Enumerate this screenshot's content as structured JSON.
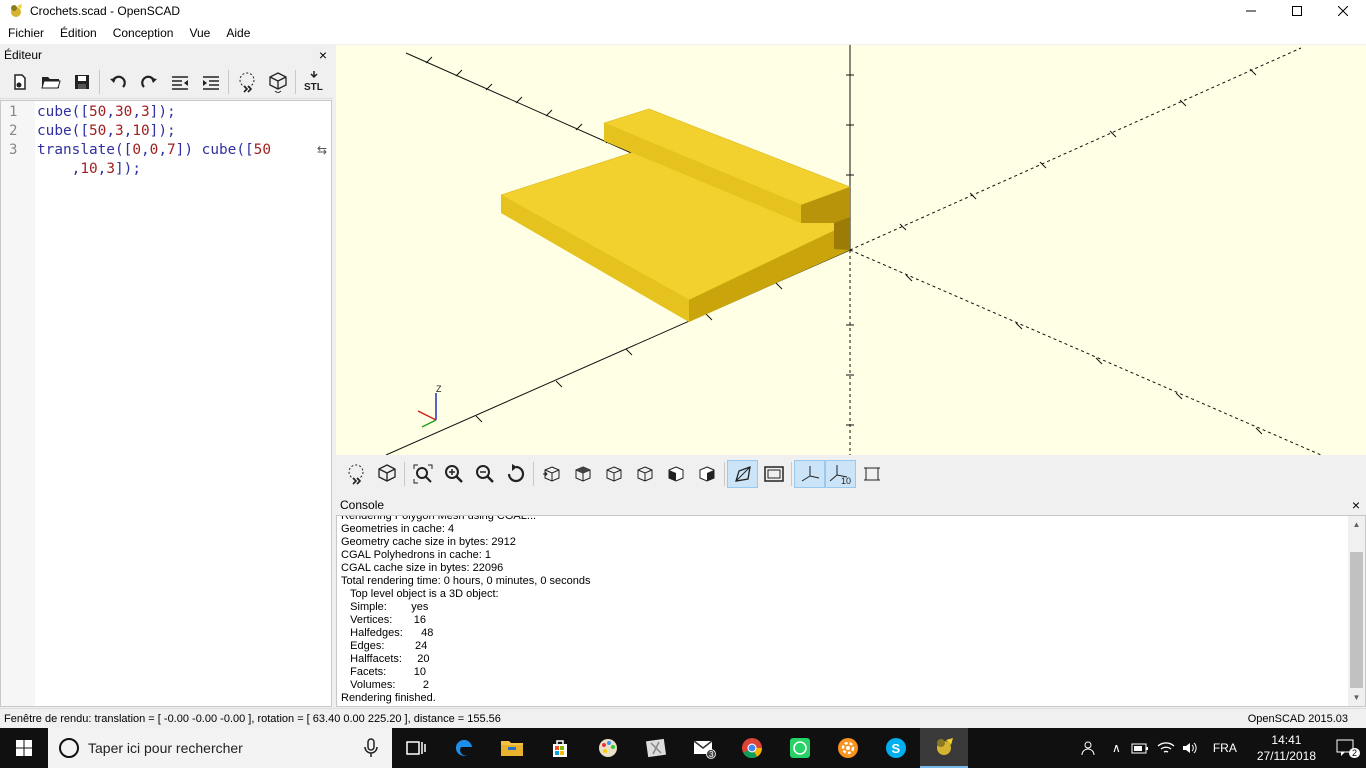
{
  "window": {
    "title": "Crochets.scad - OpenSCAD"
  },
  "menu": {
    "items": [
      "Fichier",
      "Édition",
      "Conception",
      "Vue",
      "Aide"
    ]
  },
  "editor": {
    "title": "Éditeur",
    "close": "×",
    "line_numbers": [
      "1",
      "2",
      "3"
    ],
    "lines": [
      [
        {
          "t": "cube",
          "c": "kw"
        },
        {
          "t": "(["
        },
        {
          "t": "50",
          "c": "num"
        },
        {
          "t": ","
        },
        {
          "t": "30",
          "c": "num"
        },
        {
          "t": ","
        },
        {
          "t": "3",
          "c": "num"
        },
        {
          "t": "]);"
        }
      ],
      [
        {
          "t": "cube",
          "c": "kw"
        },
        {
          "t": "(["
        },
        {
          "t": "50",
          "c": "num"
        },
        {
          "t": ","
        },
        {
          "t": "3",
          "c": "num"
        },
        {
          "t": ","
        },
        {
          "t": "10",
          "c": "num"
        },
        {
          "t": "]);"
        }
      ],
      [
        {
          "t": "translate",
          "c": "kw"
        },
        {
          "t": "(["
        },
        {
          "t": "0",
          "c": "num"
        },
        {
          "t": ","
        },
        {
          "t": "0",
          "c": "num"
        },
        {
          "t": ","
        },
        {
          "t": "7",
          "c": "num"
        },
        {
          "t": "]) "
        },
        {
          "t": "cube",
          "c": "kw"
        },
        {
          "t": "(["
        },
        {
          "t": "50",
          "c": "num"
        }
      ],
      [
        {
          "t": "    ,"
        },
        {
          "t": "10",
          "c": "num"
        },
        {
          "t": ","
        },
        {
          "t": "3",
          "c": "num"
        },
        {
          "t": "]);"
        }
      ]
    ]
  },
  "console": {
    "title": "Console",
    "close": "×",
    "lines": [
      "Rendering Polygon Mesh using CGAL...",
      "Geometries in cache: 4",
      "Geometry cache size in bytes: 2912",
      "CGAL Polyhedrons in cache: 1",
      "CGAL cache size in bytes: 22096",
      "Total rendering time: 0 hours, 0 minutes, 0 seconds",
      "   Top level object is a 3D object:",
      "   Simple:        yes",
      "   Vertices:       16",
      "   Halfedges:      48",
      "   Edges:          24",
      "   Halffacets:     20",
      "   Facets:         10",
      "   Volumes:         2",
      "Rendering finished."
    ]
  },
  "status": {
    "left": "Fenêtre de rendu: translation = [ -0.00 -0.00 -0.00 ], rotation = [ 63.40 0.00 225.20 ], distance = 155.56",
    "right": "OpenSCAD 2015.03"
  },
  "axis_label": "Z",
  "view_toolbar_label_10": "10",
  "taskbar": {
    "search_placeholder": "Taper ici pour rechercher",
    "lang": "FRA",
    "time": "14:41",
    "date": "27/11/2018",
    "notif_count": "2",
    "mail_badge": "3"
  },
  "colors": {
    "model": "#f2d12e",
    "viewport_bg": "#ffffe5"
  }
}
